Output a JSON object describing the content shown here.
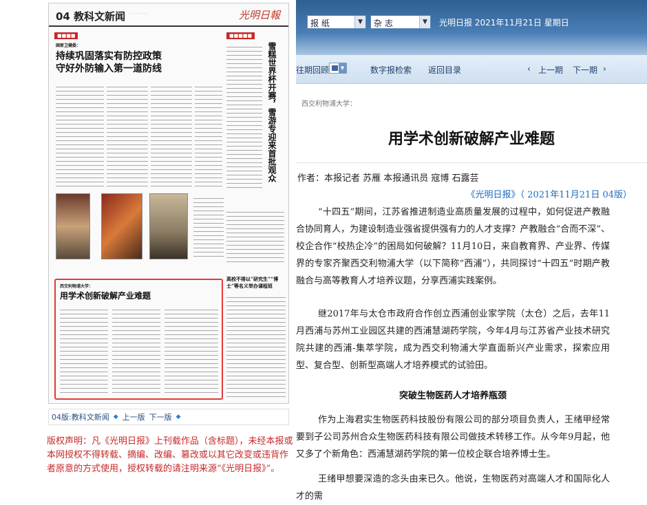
{
  "newspaper_page": {
    "page_label": "04 教科文新闻",
    "logo": "光明日報",
    "lead_kicker": "国家卫健委：",
    "lead_title_1": "持续巩固落实有防控政策",
    "lead_title_2": "守好外防输入第一道防线",
    "vertical_title": "雪糕世界杯开赛，雪游专迎来首批观众",
    "highlight_kicker": "西交利物浦大学：",
    "highlight_title": "用学术创新破解产业难题",
    "side_title": "高校不得以“研究生”“博士”等名义举办课程班"
  },
  "page_nav": {
    "label": "04版:教科文新闻",
    "prev": "上一版",
    "next": "下一版"
  },
  "copyright": "版权声明：凡《光明日报》上刊载作品（含标题），未经本报或本网授权不得转载、摘编、改编、篡改或以其它改变或违背作者原意的方式使用，授权转载的请注明来源“《光明日报》”。",
  "topbar": {
    "select_newspaper": "报  纸",
    "select_magazine": "杂  志",
    "pubdate": "光明日报  2021年11月21日  星期日"
  },
  "toolbar": {
    "past_review": "往期回顾",
    "digital_search": "数字报检索",
    "back_to_index": "返回目录",
    "prev_issue": "上一期",
    "next_issue": "下一期"
  },
  "article": {
    "kicker": "西交利物浦大学：",
    "headline": "用学术创新破解产业难题",
    "author": "作者：本报记者  苏雁  本报通讯员  寇博  石露芸",
    "source": "《光明日报》（ 2021年11月21日  04版）",
    "para1": "“十四五”期间，江苏省推进制造业高质量发展的过程中，如何促进产教融合协同育人，为建设制造业强省提供强有力的人才支撑？产教融合“合而不深”、校企合作“校热企冷”的困局如何破解？11月10日，来自教育界、产业界、传媒界的专家齐聚西交利物浦大学（以下简称“西浦”），共同探讨“十四五”时期产教融合与高等教育人才培养议题，分享西浦实践案例。",
    "para2": "继2017年与太仓市政府合作创立西浦创业家学院（太仓）之后，去年11月西浦与苏州工业园区共建的西浦慧湖药学院，今年4月与江苏省产业技术研究院共建的西浦-集萃学院，成为西交利物浦大学直面新兴产业需求，探索应用型、复合型、创新型高端人才培养模式的试验田。",
    "section": "突破生物医药人才培养瓶颈",
    "para3": "作为上海君实生物医药科技股份有限公司的部分项目负责人，王绪甲经常要到子公司苏州合众生物医药科技有限公司做技术转移工作。从今年9月起，他又多了个新角色：西浦慧湖药学院的第一位校企联合培养博士生。",
    "para4": "王绪甲想要深造的念头由来已久。他说，生物医药对高端人才和国际化人才的需"
  }
}
